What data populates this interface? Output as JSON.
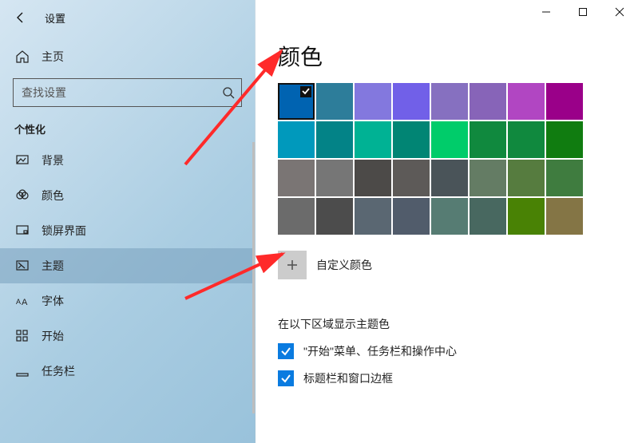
{
  "window": {
    "title": "设置"
  },
  "sidebar": {
    "home": "主页",
    "search_placeholder": "查找设置",
    "section": "个性化",
    "items": [
      {
        "label": "背景"
      },
      {
        "label": "颜色"
      },
      {
        "label": "锁屏界面"
      },
      {
        "label": "主题"
      },
      {
        "label": "字体"
      },
      {
        "label": "开始"
      },
      {
        "label": "任务栏"
      }
    ],
    "active_index": 3
  },
  "main": {
    "title": "颜色",
    "swatches": [
      [
        "#0063b1",
        "#2d7d9a",
        "#8378de",
        "#7160e8",
        "#8670c0",
        "#8764b8",
        "#b146c2",
        "#9a0089"
      ],
      [
        "#0099bc",
        "#038387",
        "#00b294",
        "#018574",
        "#00cc6a",
        "#10893e",
        "#10893e",
        "#107c10"
      ],
      [
        "#7a7574",
        "#767676",
        "#4c4a48",
        "#5d5a58",
        "#4a5459",
        "#647c64",
        "#567c3f",
        "#3f7c3f"
      ],
      [
        "#6b6b6b",
        "#4c4c4c",
        "#5a6772",
        "#515c6b",
        "#567c73",
        "#486860",
        "#498205",
        "#847545"
      ]
    ],
    "selected": {
      "row": 0,
      "col": 0
    },
    "custom_label": "自定义颜色",
    "accent": {
      "heading": "在以下区域显示主题色",
      "options": [
        {
          "label": "\"开始\"菜单、任务栏和操作中心",
          "checked": true
        },
        {
          "label": "标题栏和窗口边框",
          "checked": true
        }
      ]
    }
  }
}
